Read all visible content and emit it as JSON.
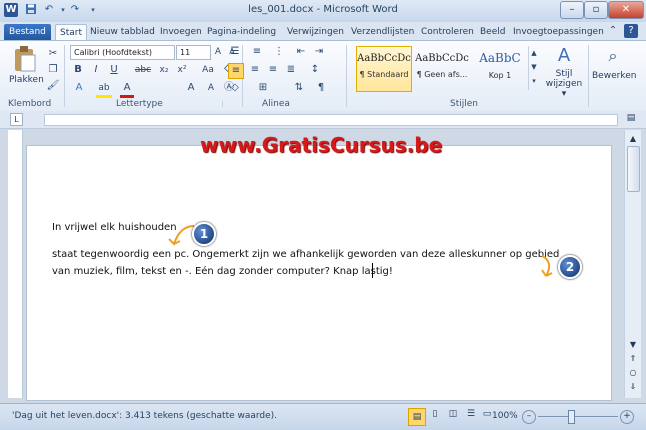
{
  "window": {
    "title": "les_001.docx - Microsoft Word"
  },
  "quick_access": [
    "W",
    "save-icon",
    "undo-icon",
    "redo-icon",
    "customize-icon"
  ],
  "tabs": [
    "Bestand",
    "Start",
    "Nieuw tabblad",
    "Invoegen",
    "Pagina-indeling",
    "Verwijzingen",
    "Verzendlijsten",
    "Controleren",
    "Beeld",
    "Invoegtoepassingen"
  ],
  "active_tab": "Start",
  "ribbon": {
    "groups": {
      "clipboard": "Klembord",
      "font": "Lettertype",
      "paragraph": "Alinea",
      "styles": "Stijlen"
    },
    "paste_label": "Plakken",
    "font_name": "Calibri (Hoofdtekst)",
    "font_size": "11",
    "styles": [
      {
        "preview": "AaBbCcDc",
        "name": "¶ Standaard",
        "selected": true
      },
      {
        "preview": "AaBbCcDc",
        "name": "¶ Geen afs...",
        "selected": false
      },
      {
        "preview": "AaBbC",
        "name": "Kop 1",
        "selected": false
      }
    ],
    "change_styles": {
      "line1": "Stijl",
      "line2": "wijzigen ▾"
    },
    "edit_label": "Bewerken"
  },
  "watermark": "www.GratisCursus.be",
  "document": {
    "line1": "In vrijwel elk huishouden",
    "line2": "staat tegenwoordig een pc. Ongemerkt zijn we afhankelijk geworden van deze alleskunner op gebied",
    "line3": "van muziek, film, tekst en -. Eén dag zonder computer? Knap lastig!"
  },
  "callouts": [
    "1",
    "2"
  ],
  "status": {
    "text": "'Dag uit het leven.docx': 3.413 tekens (geschatte waarde).",
    "zoom": "100%"
  },
  "colors": {
    "file_tab": "#2b5ca8",
    "watermark": "#d61a1a",
    "callout": "#1a3f86"
  }
}
